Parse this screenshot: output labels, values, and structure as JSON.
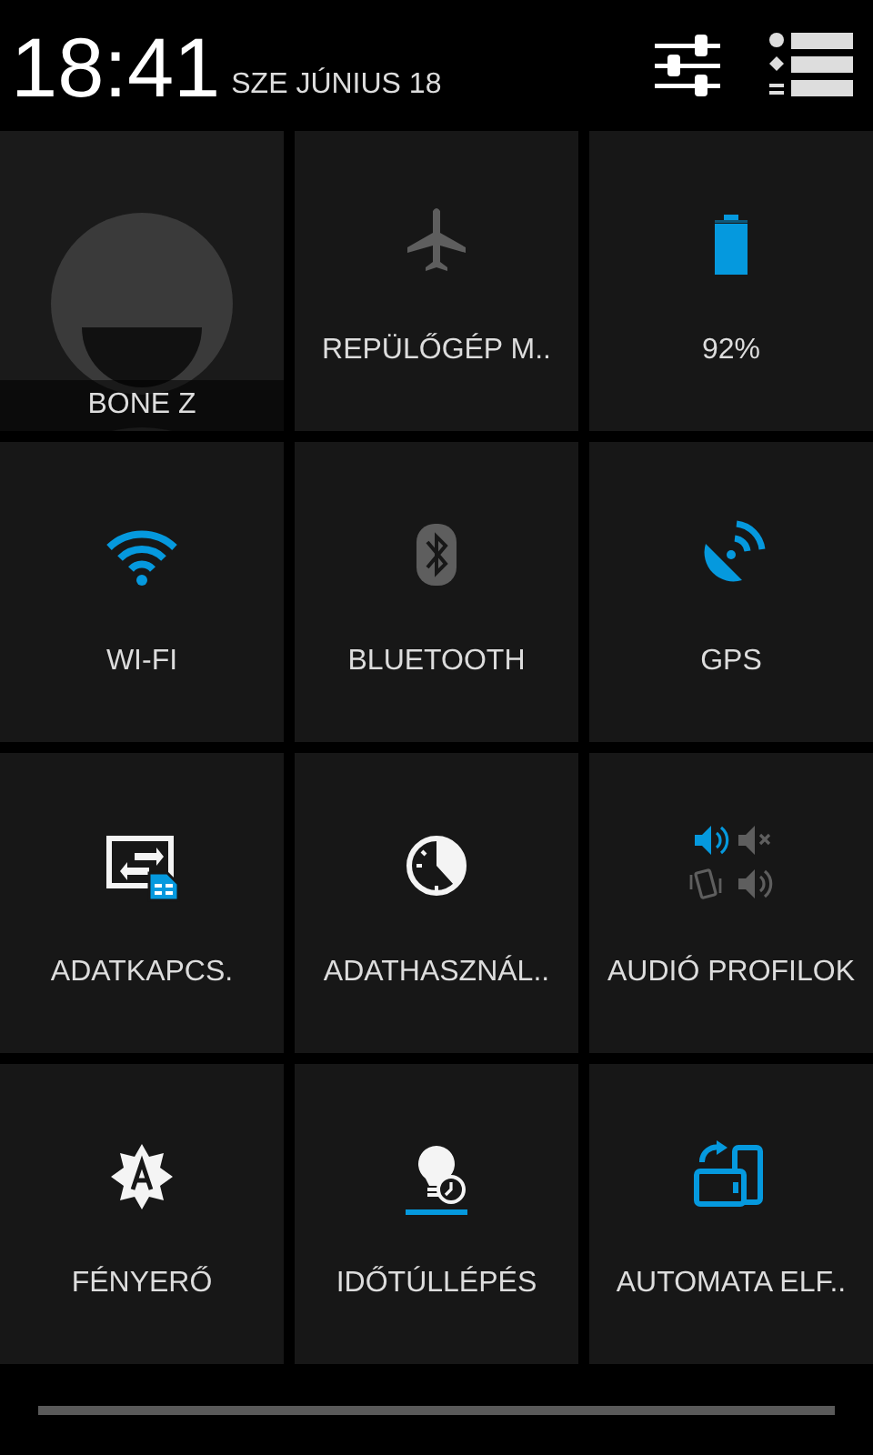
{
  "header": {
    "time": "18:41",
    "date": "SZE JÚNIUS 18"
  },
  "user": {
    "name": "BONE Z"
  },
  "tiles": [
    {
      "kind": "airplane",
      "label": "REPÜLŐGÉP M..",
      "on": false
    },
    {
      "kind": "battery",
      "label": "92%",
      "on": true
    },
    {
      "kind": "wifi",
      "label": "WI-FI",
      "on": true
    },
    {
      "kind": "bluetooth",
      "label": "BLUETOOTH",
      "on": false
    },
    {
      "kind": "gps",
      "label": "GPS",
      "on": true
    },
    {
      "kind": "data",
      "label": "ADATKAPCS.",
      "on": true
    },
    {
      "kind": "usage",
      "label": "ADATHASZNÁL..",
      "on": true
    },
    {
      "kind": "audio",
      "label": "AUDIÓ PROFILOK",
      "on": true
    },
    {
      "kind": "brightness",
      "label": "FÉNYERŐ",
      "on": true
    },
    {
      "kind": "timeout",
      "label": "IDŐTÚLLÉPÉS",
      "on": true
    },
    {
      "kind": "rotate",
      "label": "AUTOMATA ELF..",
      "on": true
    }
  ]
}
